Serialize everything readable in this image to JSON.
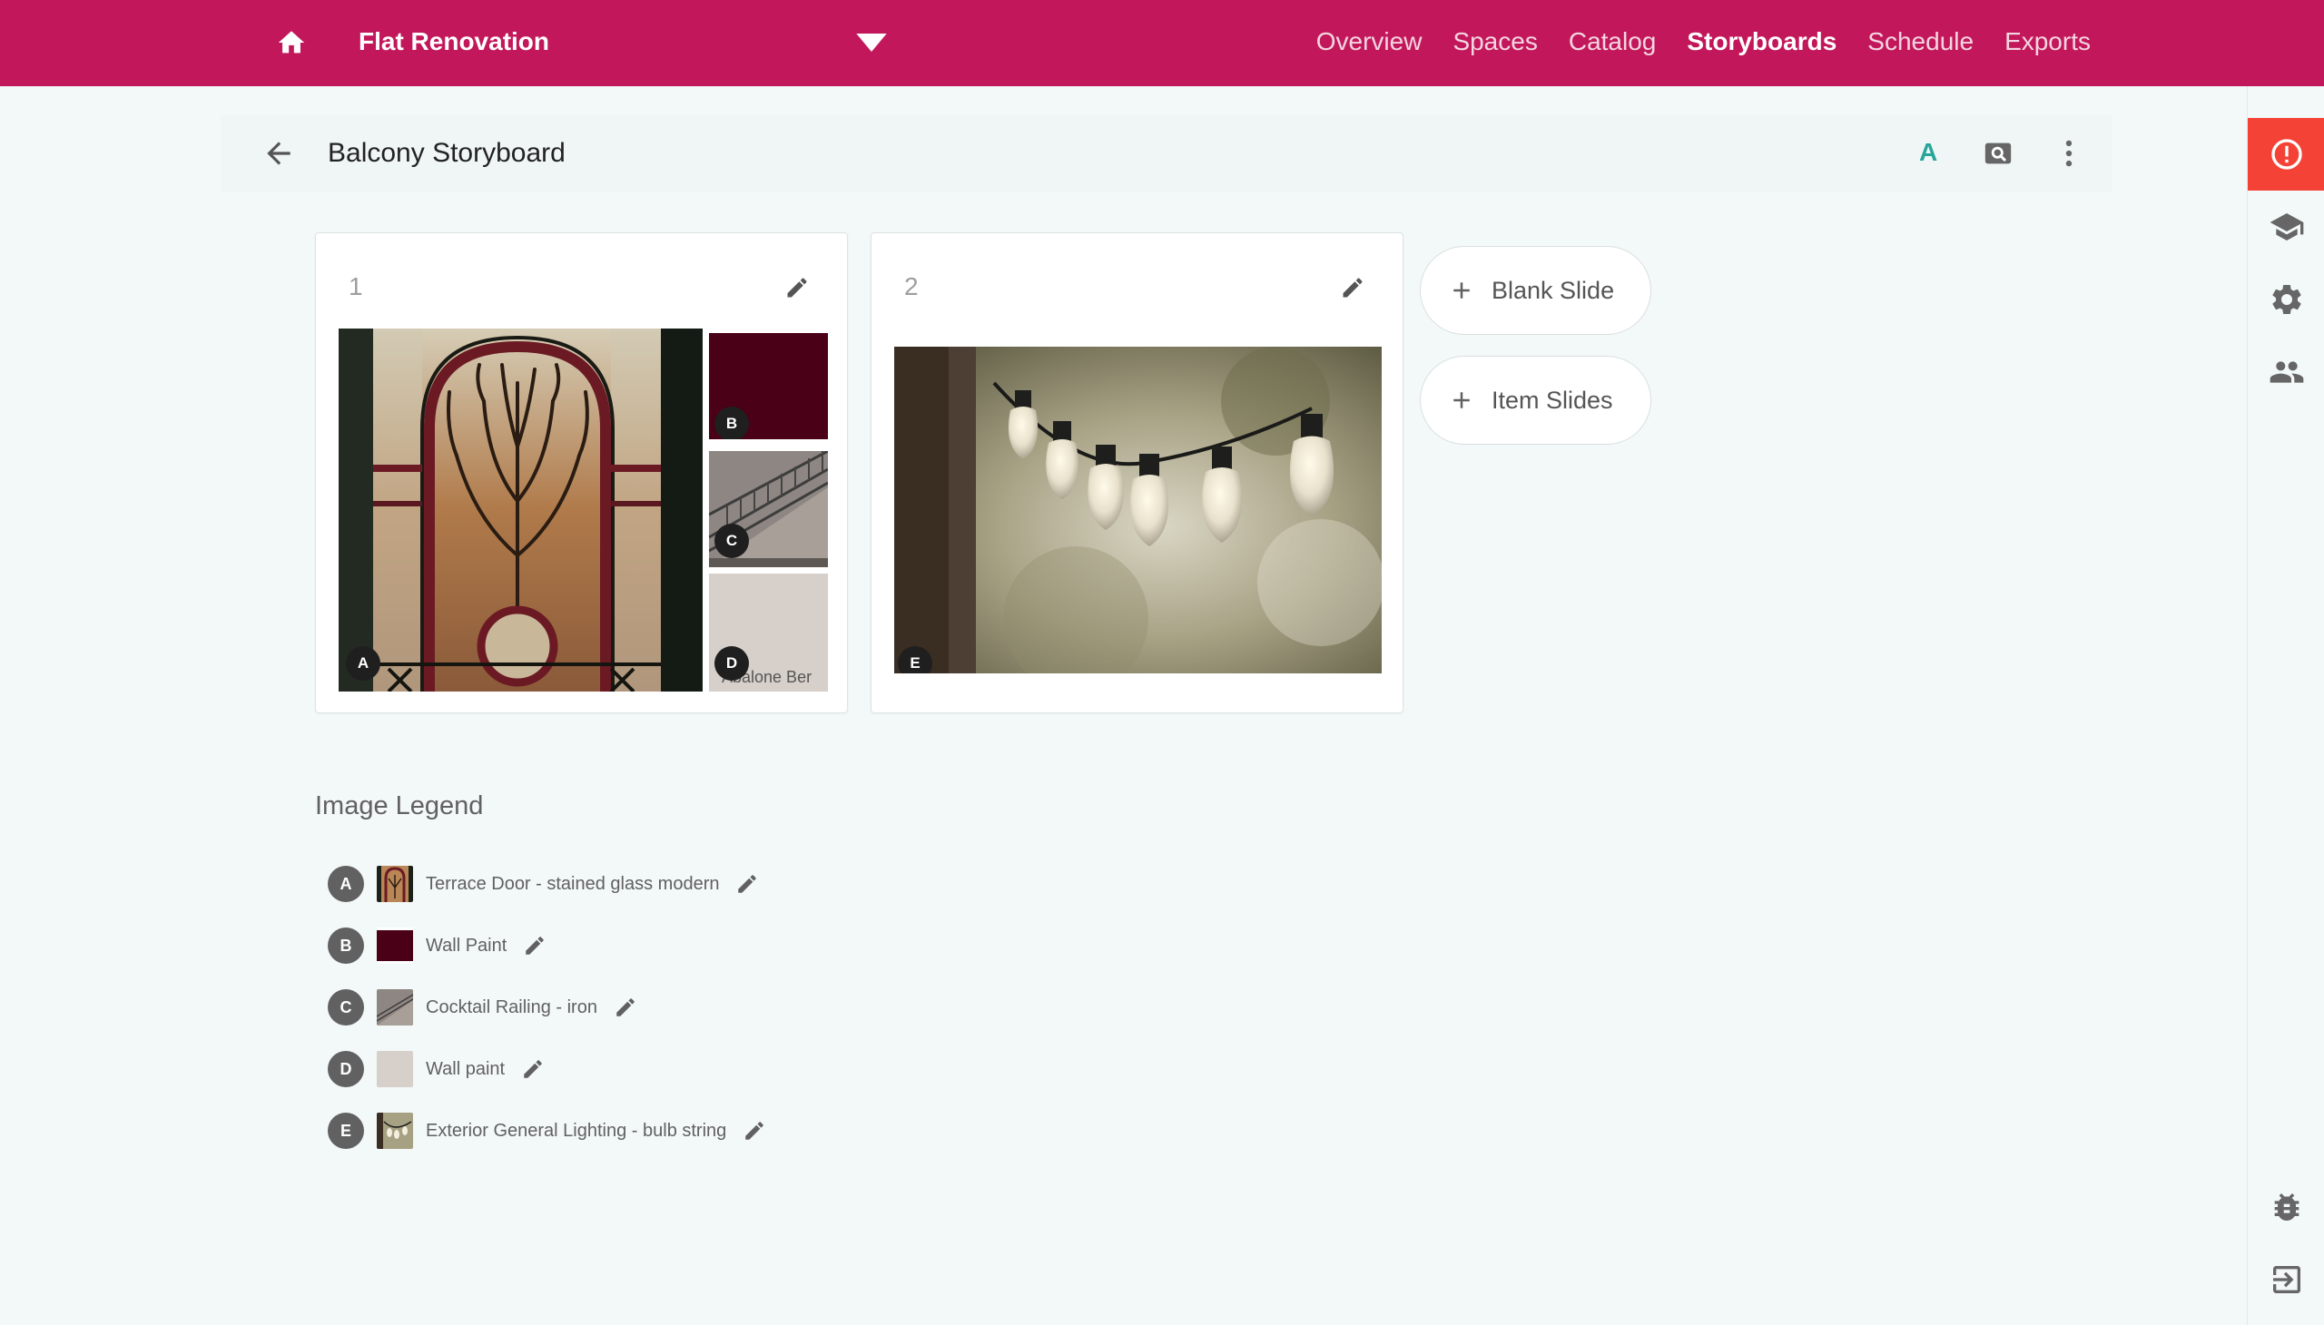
{
  "topbar": {
    "home_icon": "home-icon",
    "project_title": "Flat Renovation",
    "dropdown_icon": "triangle-down-icon",
    "nav": [
      {
        "label": "Overview",
        "active": false
      },
      {
        "label": "Spaces",
        "active": false
      },
      {
        "label": "Catalog",
        "active": false
      },
      {
        "label": "Storyboards",
        "active": true
      },
      {
        "label": "Schedule",
        "active": false
      },
      {
        "label": "Exports",
        "active": false
      }
    ],
    "color": "#c2185b"
  },
  "header": {
    "back_icon": "arrow-left-icon",
    "title": "Balcony Storyboard",
    "text_mode_label": "A",
    "text_mode_color": "#26a69a",
    "preview_icon": "image-search-icon",
    "more_icon": "more-vertical-icon"
  },
  "slides": [
    {
      "number": "1",
      "edit_icon": "pencil-icon",
      "tiles": [
        {
          "label": "A",
          "item": "stained-glass-door"
        },
        {
          "label": "B",
          "item": "burgundy-swatch"
        },
        {
          "label": "C",
          "item": "iron-railing"
        },
        {
          "label": "D",
          "item": "beige-swatch",
          "caption": "Abalone   Ber"
        }
      ]
    },
    {
      "number": "2",
      "edit_icon": "pencil-icon",
      "tiles": [
        {
          "label": "E",
          "item": "bulb-string"
        }
      ]
    }
  ],
  "actions": {
    "blank_slide": "Blank Slide",
    "item_slides": "Item Slides",
    "plus_icon": "plus-icon"
  },
  "legend": {
    "title": "Image Legend",
    "items": [
      {
        "letter": "A",
        "label": "Terrace Door - stained glass modern"
      },
      {
        "letter": "B",
        "label": "Wall Paint"
      },
      {
        "letter": "C",
        "label": "Cocktail Railing - iron"
      },
      {
        "letter": "D",
        "label": "Wall paint"
      },
      {
        "letter": "E",
        "label": "Exterior General Lighting - bulb string"
      }
    ]
  },
  "rail": {
    "items": [
      "alert-circle-icon",
      "school-icon",
      "gear-icon",
      "people-icon",
      "bug-icon",
      "logout-icon"
    ],
    "alert_color": "#f44336"
  }
}
